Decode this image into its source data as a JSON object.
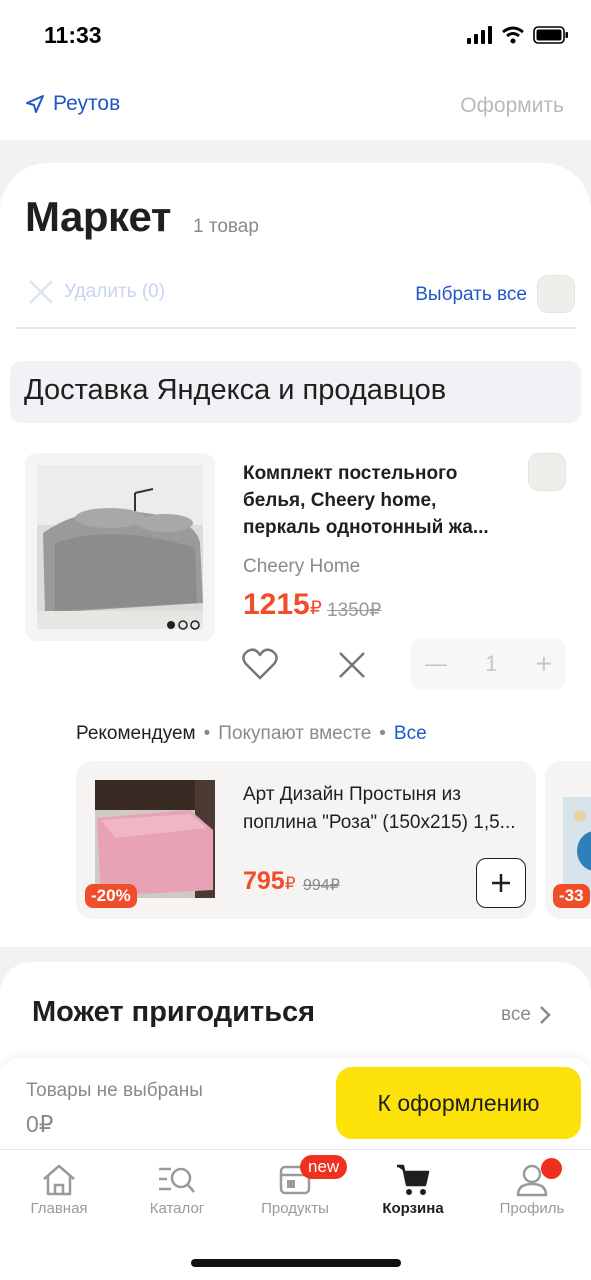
{
  "status_bar": {
    "time": "11:33"
  },
  "nav": {
    "location": "Реутов",
    "checkout_label": "Оформить"
  },
  "cart": {
    "title": "Маркет",
    "count": "1 товар",
    "delete_label": "Удалить (0)",
    "select_all_label": "Выбрать все",
    "section_title": "Доставка Яндекса и продавцов"
  },
  "product": {
    "title": "Комплект постельного белья, Cheery home, перкаль однотонный жа...",
    "brand": "Cheery Home",
    "price": "1215",
    "currency": "₽",
    "old_price": "1350₽",
    "quantity": "1"
  },
  "recommend": {
    "tab_recommend": "Рекомендуем",
    "tab_together": "Покупают вместе",
    "all_label": "Все",
    "separator": "•",
    "item": {
      "title": "Арт Дизайн Простыня из поплина \"Роза\" (150x215) 1,5...",
      "price": "795",
      "currency": "₽",
      "old_price": "994₽",
      "discount": "-20%"
    },
    "item2_discount": "-33"
  },
  "useful": {
    "title": "Может пригодиться",
    "all_label": "все"
  },
  "summary": {
    "label": "Товары не выбраны",
    "value": "0₽",
    "button_label": "К оформлению"
  },
  "tabs": [
    {
      "label": "Главная",
      "icon": "home-icon"
    },
    {
      "label": "Каталог",
      "icon": "catalog-search-icon"
    },
    {
      "label": "Продукты",
      "icon": "grocery-store-icon"
    },
    {
      "label": "Корзина",
      "icon": "cart-icon"
    },
    {
      "label": "Профиль",
      "icon": "profile-icon"
    }
  ],
  "tab_badge": "new",
  "colors": {
    "accent_blue": "#1f57c8",
    "price_red": "#f04d2b",
    "yellow": "#fde20a"
  }
}
